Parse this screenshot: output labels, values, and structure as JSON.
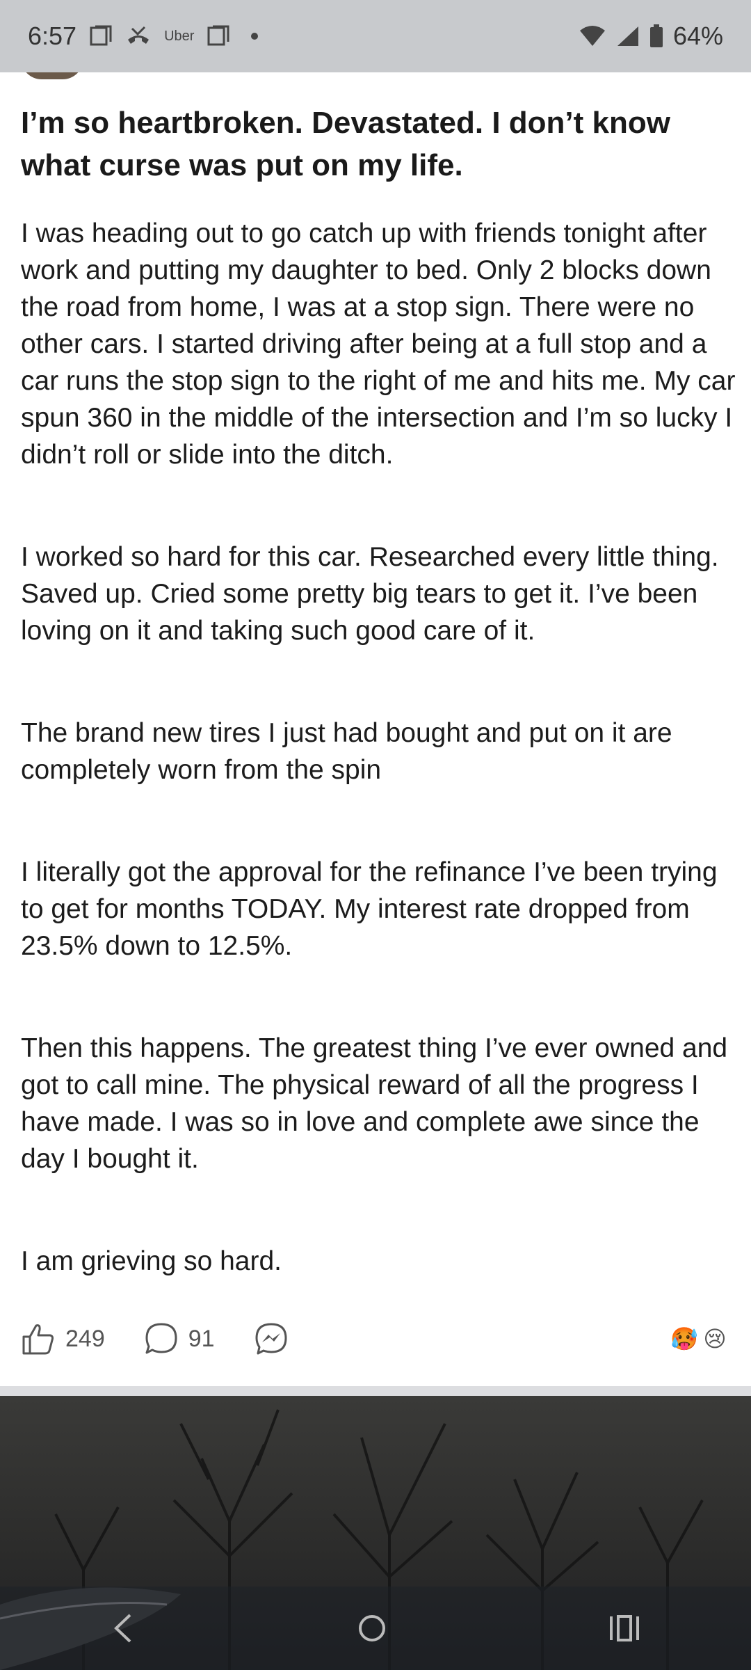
{
  "status_bar": {
    "time": "6:57",
    "uber_label": "Uber",
    "battery": "64%",
    "icons": [
      "screenshot-icon",
      "missed-call-icon",
      "uber-icon",
      "screenshot-icon",
      "notification-dot-icon",
      "wifi-icon",
      "signal-icon",
      "battery-icon"
    ]
  },
  "post": {
    "title": "I’m so heartbroken. Devastated. I don’t know what curse was put on my life.",
    "paragraphs": [
      "I was heading out to go catch up with friends tonight after work and putting my daughter to bed. Only 2 blocks down the road from home, I was at a stop sign. There were no other cars. I started driving after being at a full stop and a car runs the stop sign to the right of me and hits me. My car spun 360 in the middle of the intersection and I’m so lucky I didn’t roll or slide into the ditch.",
      "I worked so hard for this car. Researched every little thing. Saved up. Cried some pretty big tears to get it. I’ve been loving on it and taking such good care of it.",
      "The brand new tires I just had bought and put on it are completely worn from the spin",
      "I literally got the approval for the refinance I’ve been trying to get for months TODAY. My interest rate dropped from 23.5% down to 12.5%.",
      "Then this happens. The greatest thing I’ve ever owned and got to call mine. The physical reward of all the progress I have made. I was so in love and complete awe since the day I bought it.",
      "I am grieving so hard."
    ],
    "actions": {
      "like_count": "249",
      "comment_count": "91"
    },
    "reactions": [
      "🥵",
      "😢"
    ]
  },
  "colors": {
    "status_bar_bg": "#c8cacd",
    "text": "#1c1c1c",
    "divider": "#dcdde0"
  }
}
